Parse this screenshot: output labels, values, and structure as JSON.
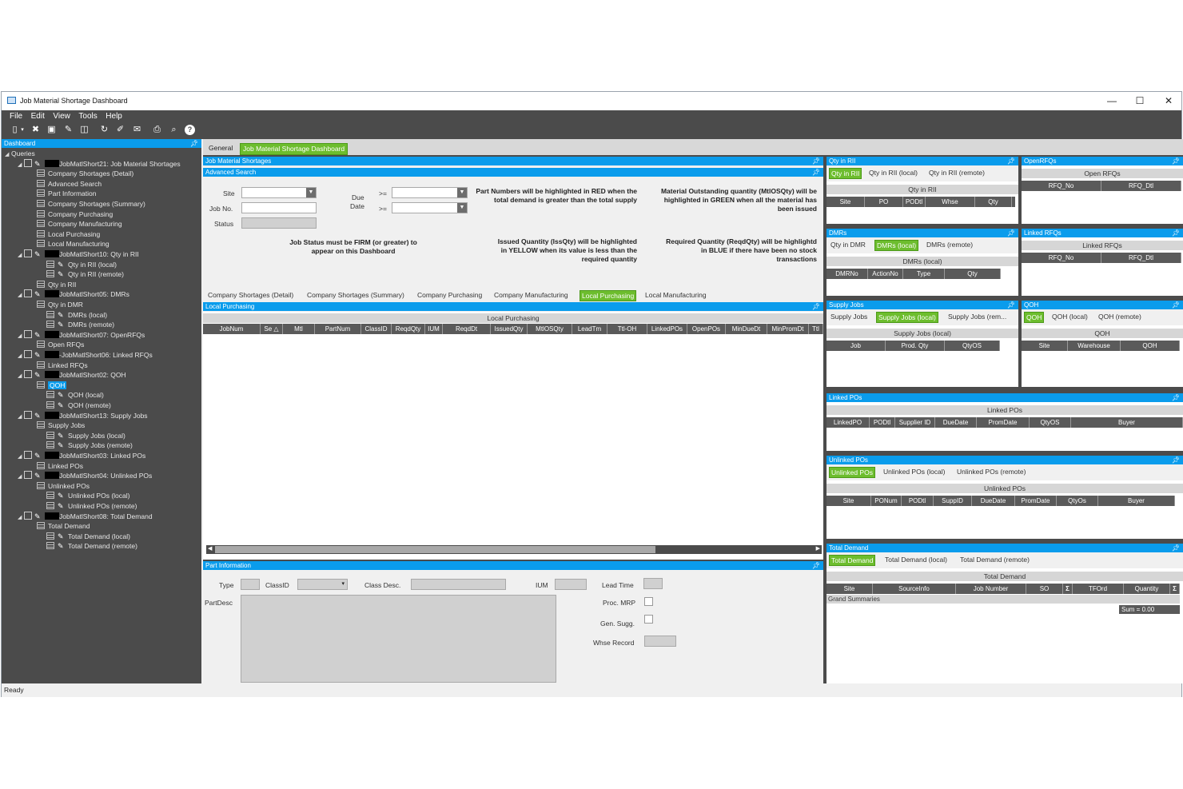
{
  "window": {
    "title": "Job Material Shortage Dashboard",
    "min": "—",
    "max": "☐",
    "close": "✕"
  },
  "menu": [
    "File",
    "Edit",
    "View",
    "Tools",
    "Help"
  ],
  "toolbar_icons": [
    "new-icon",
    "dropdown-icon",
    "delete-icon",
    "save-icon",
    "clear-icon",
    "undo-icon",
    "refresh-icon",
    "paint-icon",
    "send-icon",
    "print-icon",
    "print-preview-icon",
    "help-icon"
  ],
  "dashboard": {
    "header": "Dashboard",
    "tree": [
      {
        "label": "Queries",
        "lvl": 0,
        "type": "root"
      },
      {
        "label": "JobMatlShort21: Job Material Shortages",
        "lvl": 1,
        "type": "query"
      },
      {
        "label": "Company Shortages (Detail)",
        "lvl": 2,
        "type": "grid"
      },
      {
        "label": "Advanced Search",
        "lvl": 2,
        "type": "grid"
      },
      {
        "label": "Part Information",
        "lvl": 2,
        "type": "grid"
      },
      {
        "label": "Company Shortages (Summary)",
        "lvl": 2,
        "type": "grid"
      },
      {
        "label": "Company Purchasing",
        "lvl": 2,
        "type": "grid"
      },
      {
        "label": "Company Manufacturing",
        "lvl": 2,
        "type": "grid"
      },
      {
        "label": "Local Purchasing",
        "lvl": 2,
        "type": "grid"
      },
      {
        "label": "Local Manufacturing",
        "lvl": 2,
        "type": "grid"
      },
      {
        "label": "JobMatlShort10: Qty in RII",
        "lvl": 1,
        "type": "query"
      },
      {
        "label": "Qty in RII (local)",
        "lvl": 3,
        "type": "wgrid"
      },
      {
        "label": "Qty in RII (remote)",
        "lvl": 3,
        "type": "wgrid"
      },
      {
        "label": "Qty in RII",
        "lvl": 2,
        "type": "grid"
      },
      {
        "label": "JobMatlShort05: DMRs",
        "lvl": 1,
        "type": "query"
      },
      {
        "label": "Qty in DMR",
        "lvl": 2,
        "type": "grid"
      },
      {
        "label": "DMRs (local)",
        "lvl": 3,
        "type": "wgrid"
      },
      {
        "label": "DMRs (remote)",
        "lvl": 3,
        "type": "wgrid"
      },
      {
        "label": "JobMatlShort07: OpenRFQs",
        "lvl": 1,
        "type": "query"
      },
      {
        "label": "Open RFQs",
        "lvl": 2,
        "type": "grid"
      },
      {
        "label": "-JobMatlShort06: Linked RFQs",
        "lvl": 1,
        "type": "query"
      },
      {
        "label": "Linked RFQs",
        "lvl": 2,
        "type": "grid"
      },
      {
        "label": "JobMatlShort02: QOH",
        "lvl": 1,
        "type": "query"
      },
      {
        "label": "QOH",
        "lvl": 2,
        "type": "grid",
        "sel": true
      },
      {
        "label": "QOH (local)",
        "lvl": 3,
        "type": "wgrid"
      },
      {
        "label": "QOH (remote)",
        "lvl": 3,
        "type": "wgrid"
      },
      {
        "label": "JobMatlShort13: Supply Jobs",
        "lvl": 1,
        "type": "query"
      },
      {
        "label": "Supply Jobs",
        "lvl": 2,
        "type": "grid"
      },
      {
        "label": "Supply Jobs (local)",
        "lvl": 3,
        "type": "wgrid"
      },
      {
        "label": "Supply Jobs (remote)",
        "lvl": 3,
        "type": "wgrid"
      },
      {
        "label": "JobMatlShort03: Linked POs",
        "lvl": 1,
        "type": "query"
      },
      {
        "label": "Linked POs",
        "lvl": 2,
        "type": "grid"
      },
      {
        "label": "JobMatlShort04: Unlinked POs",
        "lvl": 1,
        "type": "query"
      },
      {
        "label": "Unlinked POs",
        "lvl": 2,
        "type": "grid"
      },
      {
        "label": "Unlinked POs (local)",
        "lvl": 3,
        "type": "wgrid"
      },
      {
        "label": "Unlinked POs (remote)",
        "lvl": 3,
        "type": "wgrid"
      },
      {
        "label": "JobMatlShort08: Total Demand",
        "lvl": 1,
        "type": "query"
      },
      {
        "label": "Total Demand",
        "lvl": 2,
        "type": "grid"
      },
      {
        "label": "Total Demand (local)",
        "lvl": 3,
        "type": "wgrid"
      },
      {
        "label": "Total Demand (remote)",
        "lvl": 3,
        "type": "wgrid"
      }
    ]
  },
  "main_tabs": [
    "General",
    "Job Material Shortage Dashboard"
  ],
  "jms": {
    "header": "Job Material Shortages",
    "adv_header": "Advanced Search",
    "site_label": "Site",
    "jobno_label": "Job No.",
    "status_label": "Status",
    "due_label": "Due",
    "date_label": "Date",
    "ge1": ">=",
    "ge2": ">=",
    "note_firm": "Job Status must be FIRM (or greater) to appear on this Dashboard",
    "note_red": "Part Numbers will be highlighted in RED when the total demand is greater than the total supply",
    "note_green": "Material Outstanding quantity (MtlOSQty) will be highlighted in GREEN when all the material has been issued",
    "note_yellow": "Issued Quantity (IssQty) will be highlighted in YELLOW when its value is less than the required quantity",
    "note_blue": "Required Quantity (ReqdQty) will be highlightd in BLUE if there have been no stock transactions"
  },
  "sub_tabs": [
    "Company Shortages (Detail)",
    "Company Shortages (Summary)",
    "Company Purchasing",
    "Company Manufacturing",
    "Local Purchasing",
    "Local Manufacturing"
  ],
  "local_purchasing": {
    "header": "Local Purchasing",
    "band": "Local Purchasing",
    "columns": [
      "JobNum",
      "Se △",
      "Mtl",
      "PartNum",
      "ClassID",
      "ReqdQty",
      "IUM",
      "ReqdDt",
      "IssuedQty",
      "MtlOSQty",
      "LeadTm",
      "Ttl-OH",
      "LinkedPOs",
      "OpenPOs",
      "MinDueDt",
      "MinPromDt",
      "Ttl"
    ]
  },
  "part_info": {
    "header": "Part Information",
    "type_label": "Type",
    "classid_label": "ClassID",
    "classdesc_label": "Class Desc.",
    "ium_label": "IUM",
    "leadtime_label": "Lead Time",
    "partdesc_label": "PartDesc",
    "procmrp_label": "Proc. MRP",
    "gensugg_label": "Gen. Sugg.",
    "whse_label": "Whse Record"
  },
  "qty_rii": {
    "header": "Qty in RII",
    "tabs": [
      "Qty in RII",
      "Qty in RII (local)",
      "Qty in RII (remote)"
    ],
    "band": "Qty in RII",
    "columns": [
      "Site",
      "PO",
      "PODtl",
      "Whse",
      "Qty"
    ]
  },
  "open_rfqs": {
    "header": "OpenRFQs",
    "band": "Open RFQs",
    "columns": [
      "RFQ_No",
      "RFQ_Dtl"
    ]
  },
  "dmrs": {
    "header": "DMRs",
    "tabs": [
      "Qty in DMR",
      "DMRs (local)",
      "DMRs (remote)"
    ],
    "band": "DMRs (local)",
    "columns": [
      "DMRNo",
      "ActionNo",
      "Type",
      "Qty"
    ]
  },
  "linked_rfqs": {
    "header": "Linked RFQs",
    "band": "Linked RFQs",
    "columns": [
      "RFQ_No",
      "RFQ_Dtl"
    ]
  },
  "supply_jobs": {
    "header": "Supply Jobs",
    "tabs": [
      "Supply Jobs",
      "Supply Jobs (local)",
      "Supply Jobs (rem..."
    ],
    "band": "Supply Jobs (local)",
    "columns": [
      "Job",
      "Prod. Qty",
      "QtyOS"
    ]
  },
  "qoh": {
    "header": "QOH",
    "tabs": [
      "QOH",
      "QOH (local)",
      "QOH (remote)"
    ],
    "band": "QOH",
    "columns": [
      "Site",
      "Warehouse",
      "QOH"
    ]
  },
  "linked_pos": {
    "header": "Linked POs",
    "band": "Linked POs",
    "columns": [
      "LinkedPO",
      "PODtl",
      "Supplier ID",
      "DueDate",
      "PromDate",
      "QtyOS",
      "Buyer"
    ]
  },
  "unlinked_pos": {
    "header": "Unlinked POs",
    "tabs": [
      "Unlinked POs",
      "Unlinked POs (local)",
      "Unlinked POs (remote)"
    ],
    "band": "Unlinked POs",
    "columns": [
      "Site",
      "PONum",
      "PODtl",
      "SuppID",
      "DueDate",
      "PromDate",
      "QtyOs",
      "Buyer"
    ]
  },
  "total_demand": {
    "header": "Total Demand",
    "tabs": [
      "Total Demand",
      "Total Demand (local)",
      "Total Demand (remote)"
    ],
    "band": "Total Demand",
    "columns": [
      "Site",
      "SourceInfo",
      "Job Number",
      "SO",
      "Σ",
      "TFOrd",
      "Quantity",
      "Σ"
    ],
    "grand": "Grand Summaries",
    "sum": "Sum = 0.00"
  },
  "status": "Ready",
  "colors": {
    "accent": "#0a9cec",
    "active_tab": "#6dbd2e",
    "chrome": "#4b4b4b"
  }
}
